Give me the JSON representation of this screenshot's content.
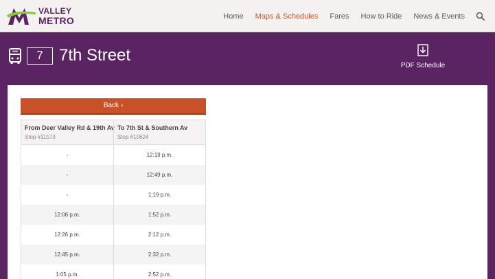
{
  "header": {
    "logo_line1": "VALLEY",
    "logo_line2": "METRO",
    "nav": [
      {
        "label": "Home",
        "active": false
      },
      {
        "label": "Maps & Schedules",
        "active": true
      },
      {
        "label": "Fares",
        "active": false
      },
      {
        "label": "How to Ride",
        "active": false
      },
      {
        "label": "News & Events",
        "active": false
      }
    ],
    "search_icon": "search-icon"
  },
  "route": {
    "icon": "bus-icon",
    "number": "7",
    "name": "7th Street",
    "pdf_label": "PDF Schedule",
    "pdf_icon": "download-icon"
  },
  "schedule": {
    "back_label": "Back ›",
    "from": {
      "name": "From Deer Valley Rd & 19th Av",
      "stop": "Stop #11573"
    },
    "to": {
      "name": "To 7th St & Southern Av",
      "stop": "Stop #10624"
    },
    "rows": [
      [
        "-",
        "12:19 p.m."
      ],
      [
        "-",
        "12:49 p.m."
      ],
      [
        "-",
        "1:19 p.m."
      ],
      [
        "12:06 p.m.",
        "1:52 p.m."
      ],
      [
        "12:26 p.m.",
        "2:12 p.m."
      ],
      [
        "12:45 p.m.",
        "2:32 p.m."
      ],
      [
        "1:05 p.m.",
        "2:52 p.m."
      ]
    ]
  },
  "colors": {
    "brand_purple": "#5a2462",
    "accent_orange": "#c9512a",
    "logo_green": "#8dc63f"
  }
}
